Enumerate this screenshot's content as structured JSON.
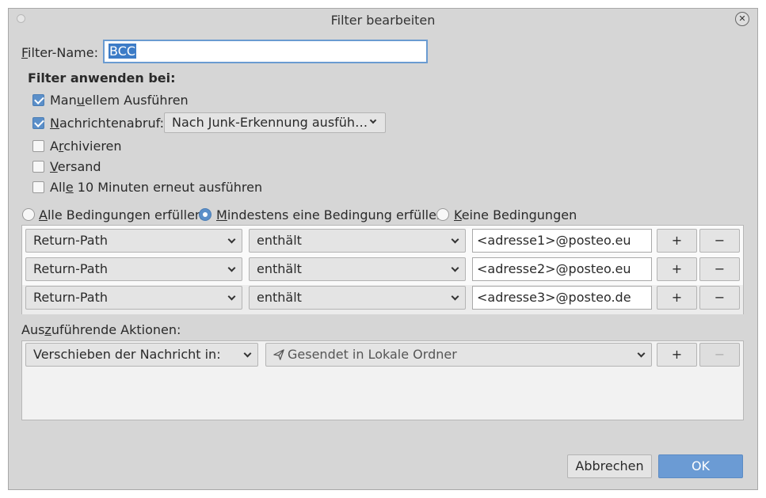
{
  "window": {
    "title": "Filter bearbeiten"
  },
  "filter_name": {
    "label_mnemonic": "F",
    "label_rest": "ilter-Name:",
    "value": "BCC"
  },
  "apply_section": {
    "heading": "Filter anwenden bei:",
    "manual": {
      "pre": "Man",
      "mnemonic": "u",
      "post": "ellem Ausführen",
      "checked": true
    },
    "fetch": {
      "pre": "",
      "mnemonic": "N",
      "post": "achrichtenabruf:",
      "checked": true,
      "dropdown": "Nach Junk-Erkennung ausfüh…"
    },
    "archive": {
      "pre": "A",
      "mnemonic": "r",
      "post": "chivieren",
      "checked": false
    },
    "send": {
      "pre": "",
      "mnemonic": "V",
      "post": "ersand",
      "checked": false
    },
    "periodic": {
      "pre": "All",
      "mnemonic": "e",
      "post": " 10 Minuten erneut ausführen",
      "checked": false
    }
  },
  "match_mode": {
    "all": {
      "mnemonic": "A",
      "rest": "lle Bedingungen erfüllen",
      "selected": false
    },
    "any": {
      "mnemonic": "M",
      "rest": "indestens eine Bedingung erfüllen",
      "selected": true
    },
    "none": {
      "mnemonic": "K",
      "rest": "eine Bedingungen",
      "selected": false
    }
  },
  "rules": [
    {
      "field": "Return-Path",
      "operator": "enthält",
      "value": "<adresse1>@posteo.eu",
      "add": "+",
      "remove": "−"
    },
    {
      "field": "Return-Path",
      "operator": "enthält",
      "value": "<adresse2>@posteo.eu",
      "add": "+",
      "remove": "−"
    },
    {
      "field": "Return-Path",
      "operator": "enthält",
      "value": "<adresse3>@posteo.de",
      "add": "+",
      "remove": "−"
    }
  ],
  "actions_section": {
    "label_pre": "Aus",
    "label_mnemonic": "z",
    "label_post": "uführende Aktionen:",
    "action": "Verschieben der Nachricht in:",
    "target": "Gesendet in Lokale Ordner",
    "target_icon": "send-icon",
    "add": "+",
    "remove": "−"
  },
  "buttons": {
    "cancel": "Abbrechen",
    "ok": "OK"
  },
  "colors": {
    "accent": "#5b8fc9",
    "ok_button": "#6b9bd4",
    "selection": "#3d7cc7"
  }
}
